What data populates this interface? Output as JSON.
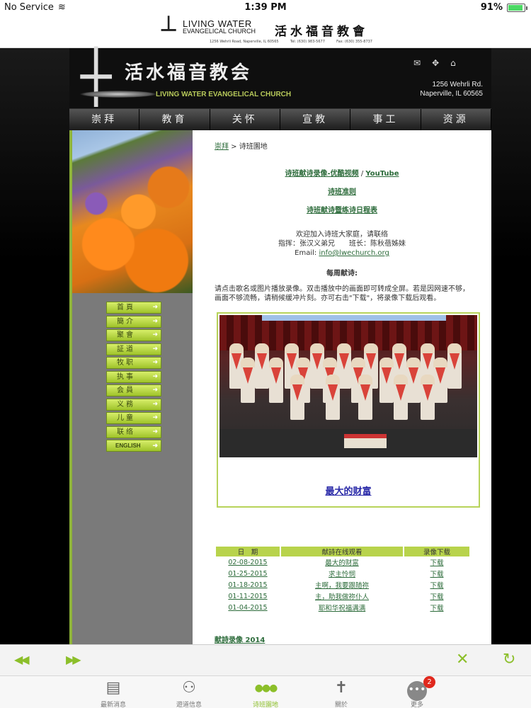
{
  "status_bar": {
    "carrier": "No Service",
    "time": "1:39 PM",
    "battery": "91%",
    "battery_level": 0.91
  },
  "app_header": {
    "logo_en_line1": "LIVING WATER",
    "logo_en_line2": "EVANGELICAL CHURCH",
    "logo_zh": "活水福音教會",
    "address": "1256 Wehrli Road, Naperville, IL 60565",
    "tel": "Tel: (630) 983-5677",
    "fax": "Fax: (630) 355-8737"
  },
  "banner": {
    "title_zh": "活水福音教会",
    "title_en": "LIVING WATER EVANGELICAL CHURCH",
    "address_line1": "1256 Wehrli Rd.",
    "address_line2": "Naperville, IL 60565"
  },
  "nav": [
    "崇拜",
    "教育",
    "关怀",
    "宣教",
    "事工",
    "资源"
  ],
  "sidebar_menu": [
    "首頁",
    "簡介",
    "聚會",
    "証道",
    "牧职",
    "执事",
    "会員",
    "义務",
    "儿童",
    "联络",
    "ENGLISH"
  ],
  "breadcrumb": {
    "parent": "崇拜",
    "separator": " > ",
    "current": "诗班園地"
  },
  "links": {
    "video_link": "诗班献诗录像-优酷视频",
    "sep": " / ",
    "youtube": "YouTube",
    "rules": "诗班准则",
    "schedule": "诗班献诗暨练诗日程表"
  },
  "welcome": {
    "line1": "欢迎加入诗班大家庭，请联络",
    "line2": "指挥：张汉义弟兄　　班长：陈秋蓓姊妹",
    "email_label": "Email: ",
    "email": "info@lwechurch.org"
  },
  "weekly_heading": "每周献诗:",
  "intro": "请点击歌名或图片播放录像。双击播放中的画面即可转成全屏。若是因网速不够，画面不够流畅，请稍候缓冲片刻。亦可右击\"下载\"，将录像下载后观看。",
  "video_caption": "最大的财富",
  "table": {
    "headers": [
      "日　期",
      "献詩在线观看",
      "录像下载"
    ],
    "rows": [
      [
        "02-08-2015",
        "最大的财富",
        "下载"
      ],
      [
        "01-25-2015",
        "求主怜悯",
        "下载"
      ],
      [
        "01-18-2015",
        "主啊，我要跟随祢",
        "下载"
      ],
      [
        "01-11-2015",
        "主，助我做祢仆人",
        "下载"
      ],
      [
        "01-04-2015",
        "耶和华祝福满满",
        "下载"
      ]
    ]
  },
  "more_link": "献詩录像 2014",
  "toolbar": {
    "back": "◀◀",
    "forward": "▶▶",
    "close": "✕",
    "reload": "↻"
  },
  "tabs": [
    {
      "label": "最新消息",
      "icon": "newspaper-icon",
      "glyph": "▤"
    },
    {
      "label": "遊道信息",
      "icon": "people-icon",
      "glyph": "⚇"
    },
    {
      "label": "诗班園地",
      "icon": "choir-icon",
      "glyph": "●●●"
    },
    {
      "label": "關於",
      "icon": "cross-logo-icon",
      "glyph": "✝"
    },
    {
      "label": "更多",
      "icon": "more-icon",
      "glyph": "•••",
      "badge": "2"
    }
  ],
  "colors": {
    "accent_green": "#8cbf2a",
    "link_green": "#2c6b3a",
    "table_header": "#b8d34c",
    "badge_red": "#e0281d"
  }
}
